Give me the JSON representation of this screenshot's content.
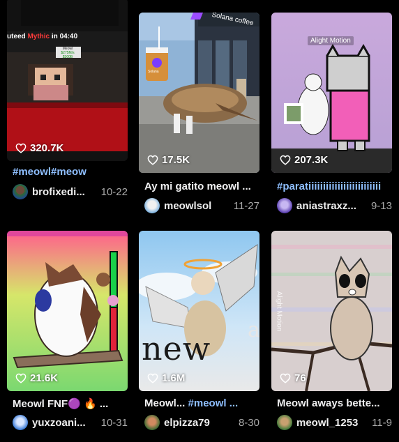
{
  "videos": [
    {
      "likes": "320.7K",
      "caption_tag": "#meowl#meow",
      "caption_text": "",
      "author": "brofixedi...",
      "date": "10-22",
      "overlay": {
        "title_left": "uteed",
        "title_mythic": "Mythic",
        "title_right": "in 04:40",
        "line1": "Meowl",
        "line2": "$275M/s",
        "line3": "$300B"
      }
    },
    {
      "likes": "17.5K",
      "caption_tag": "",
      "caption_text": "Ay mi gatito meowl ...",
      "author": "meowlsol",
      "date": "11-27",
      "overlay": {
        "sign": "Solana coffee",
        "cup": "Solana"
      }
    },
    {
      "likes": "207.3K",
      "caption_tag": "#paratiiiiiiiiiiiiiiiiiiiiiiiii",
      "caption_text": "",
      "author": "aniastraxz...",
      "date": "9-13",
      "overlay": {
        "watermark": "Alight Motion"
      }
    },
    {
      "likes": "21.6K",
      "caption_tag": "",
      "caption_text": "Meowl FNF🟣 🔥 ...",
      "author": "yuxzoani...",
      "date": "10-31",
      "overlay": {}
    },
    {
      "likes": "1.6M",
      "caption_tag": "#meowl ...",
      "caption_text": "Meowl... ",
      "author": "elpizza79",
      "date": "8-30",
      "overlay": {
        "big_text": "new",
        "big_text_right": "a"
      }
    },
    {
      "likes": "76",
      "caption_tag": "",
      "caption_text": "Meowl aways bette...",
      "author": "meowl_1253",
      "date": "11-9",
      "overlay": {
        "watermark": "Alight Motion"
      }
    }
  ],
  "icons": {
    "likes": "heart-outline-icon"
  },
  "colors": {
    "background": "#000000",
    "hashtag": "#8fbfff",
    "date": "#aaaaaa"
  }
}
